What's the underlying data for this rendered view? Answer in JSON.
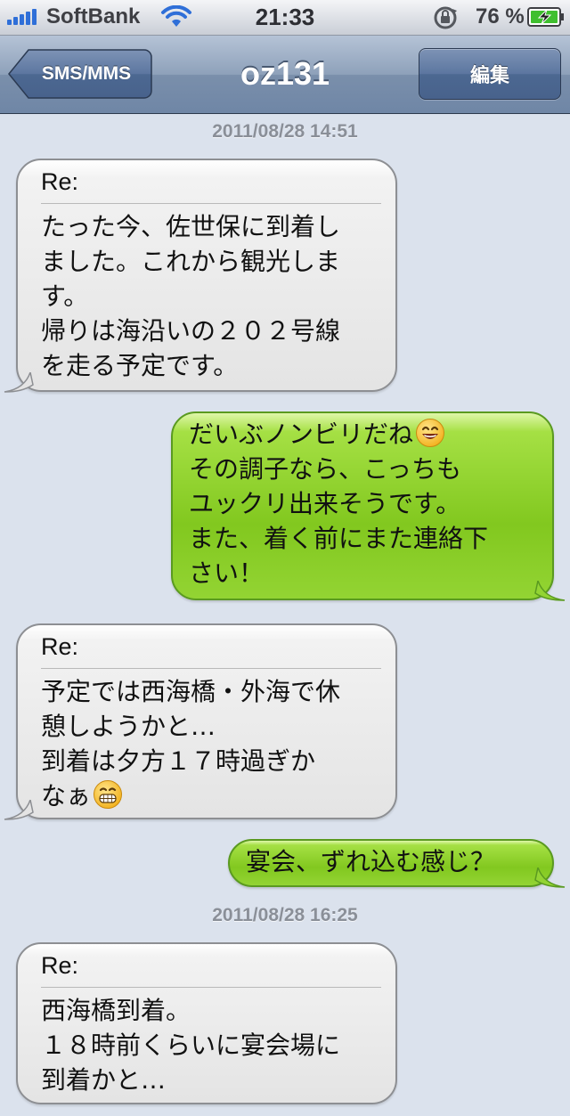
{
  "status_bar": {
    "carrier": "SoftBank",
    "time": "21:33",
    "battery_percent": "76 %",
    "signal_icon": "signal-bars-icon",
    "wifi_icon": "wifi-icon",
    "lock_icon": "rotation-lock-icon",
    "battery_icon": "battery-charging-icon"
  },
  "nav": {
    "back_label": "SMS/MMS",
    "title": "oz131",
    "edit_label": "編集"
  },
  "colors": {
    "nav_blue": "#6f86a6",
    "background": "#dbe2ed",
    "outgoing_green": "#82c81f",
    "incoming_gray": "#e4e4e4",
    "timestamp_gray": "#8a8f98"
  },
  "messages": {
    "timestamp_1": "2011/08/28  14:51",
    "m1": {
      "subject": "Re:",
      "lines": [
        "たった今、佐世保に到着し",
        "ました。これから観光しま",
        "す。",
        "帰りは海沿いの２０２号線",
        "を走る予定です。"
      ]
    },
    "m2": {
      "lines": [
        "だいぶノンビリだね",
        "その調子なら、こっちも",
        "ユックリ出来そうです。",
        "また、着く前にまた連絡下",
        "さい！"
      ],
      "emoji": "smiling-face-icon"
    },
    "m3": {
      "subject": "Re:",
      "lines": [
        "予定では西海橋・外海で休",
        "憩しようかと…",
        "到着は夕方１７時過ぎか",
        "なぁ"
      ],
      "emoji": "grinning-face-icon"
    },
    "m4": {
      "lines": [
        "宴会、ずれ込む感じ？"
      ]
    },
    "timestamp_2": "2011/08/28  16:25",
    "m5": {
      "subject": "Re:",
      "lines": [
        "西海橋到着。",
        "１８時前くらいに宴会場に",
        "到着かと…"
      ]
    }
  }
}
